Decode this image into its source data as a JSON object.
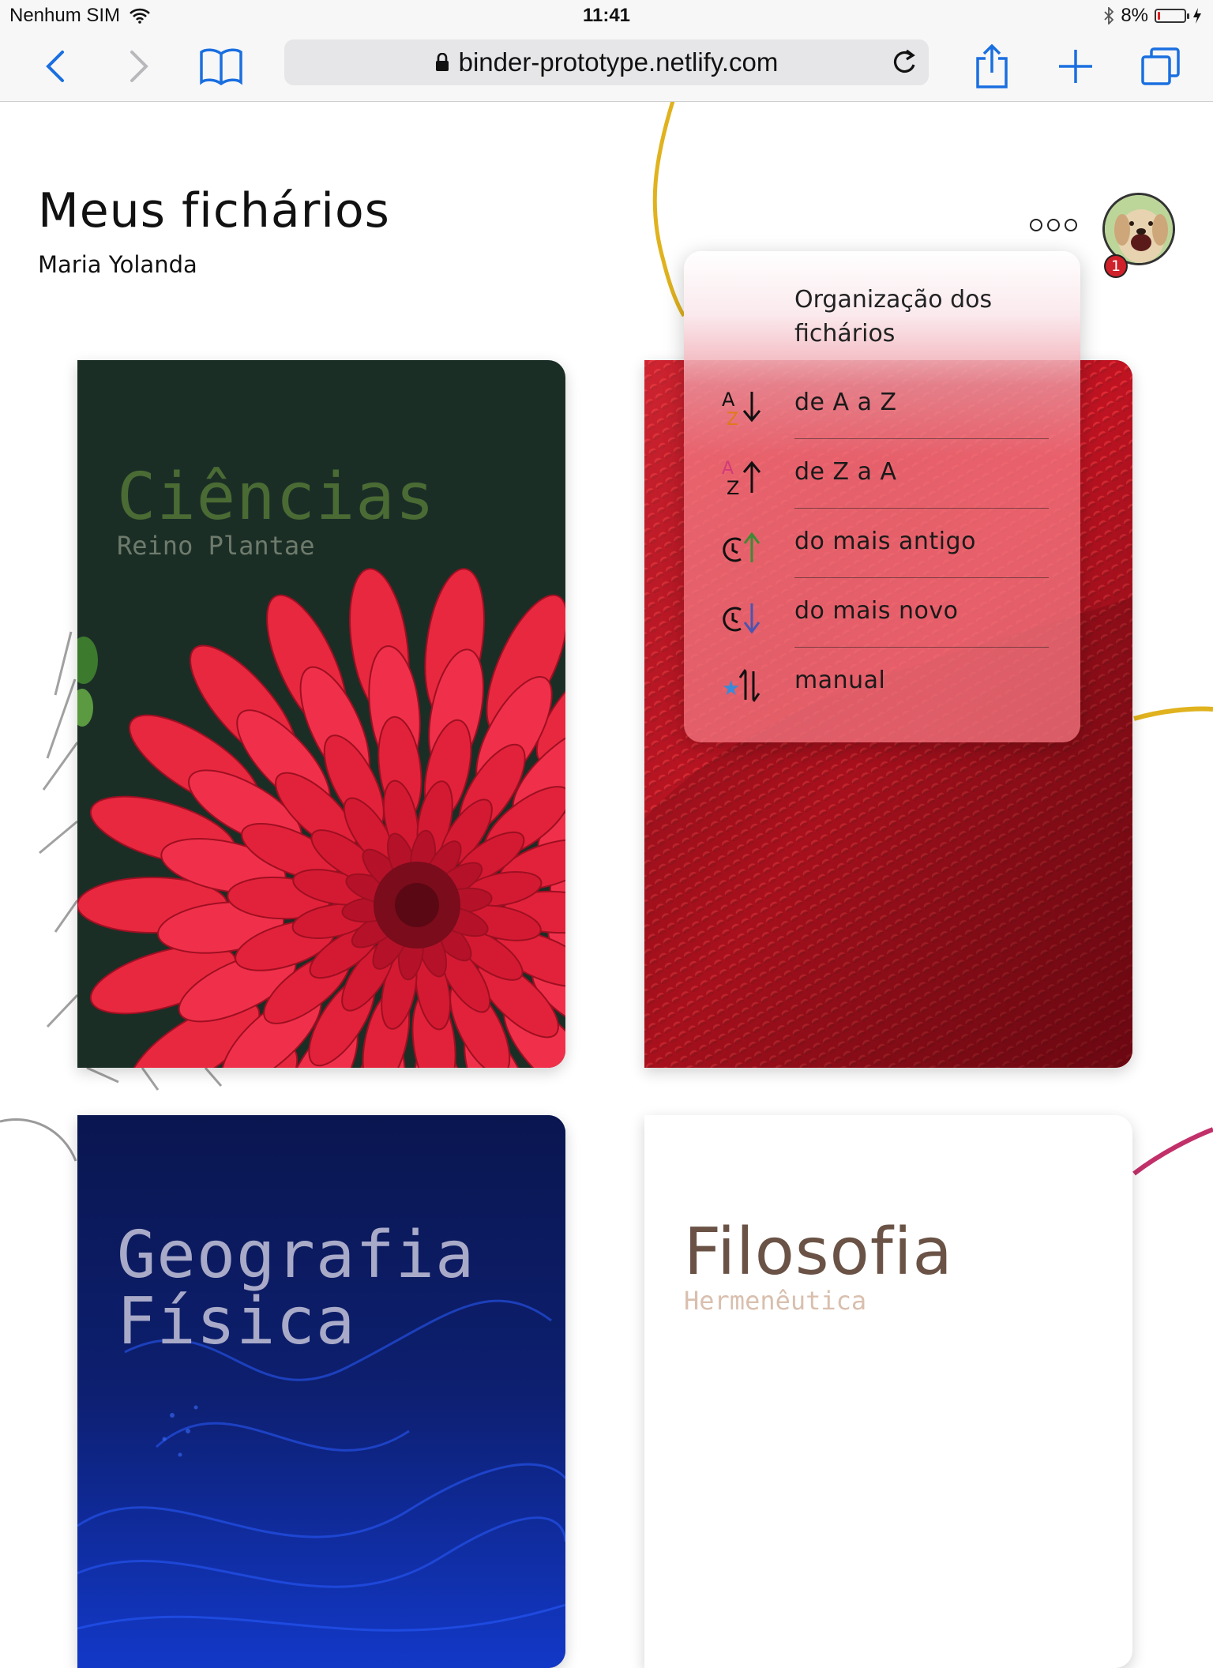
{
  "status_bar": {
    "carrier": "Nenhum SIM",
    "time": "11:41",
    "battery": "8%",
    "battery_level": 0.08
  },
  "browser": {
    "url": "binder-prototype.netlify.com"
  },
  "header": {
    "title": "Meus fichários",
    "user": "Maria Yolanda",
    "notification_count": "1"
  },
  "sort_menu": {
    "title": "Organização dos fichários",
    "items": [
      {
        "label": "de A a Z",
        "icon": "sort-a-to-z-icon"
      },
      {
        "label": "de Z a A",
        "icon": "sort-z-to-a-icon"
      },
      {
        "label": "do mais antigo",
        "icon": "sort-oldest-icon"
      },
      {
        "label": "do mais novo",
        "icon": "sort-newest-icon"
      },
      {
        "label": "manual",
        "icon": "sort-manual-icon"
      }
    ]
  },
  "binders": [
    {
      "title": "Ciências",
      "subtitle": "Reino Plantae",
      "cover": "red dahlia flower",
      "title_color": "#4a6b34"
    },
    {
      "title": "",
      "subtitle": "",
      "cover": "red woven fabric"
    },
    {
      "title": "Geografia\nFísica",
      "subtitle": "",
      "cover": "blue smoke waves",
      "title_color": "#a8aac8"
    },
    {
      "title": "Filosofia",
      "subtitle": "Hermenêutica",
      "cover": "plain white",
      "title_color": "#6a5346"
    }
  ]
}
